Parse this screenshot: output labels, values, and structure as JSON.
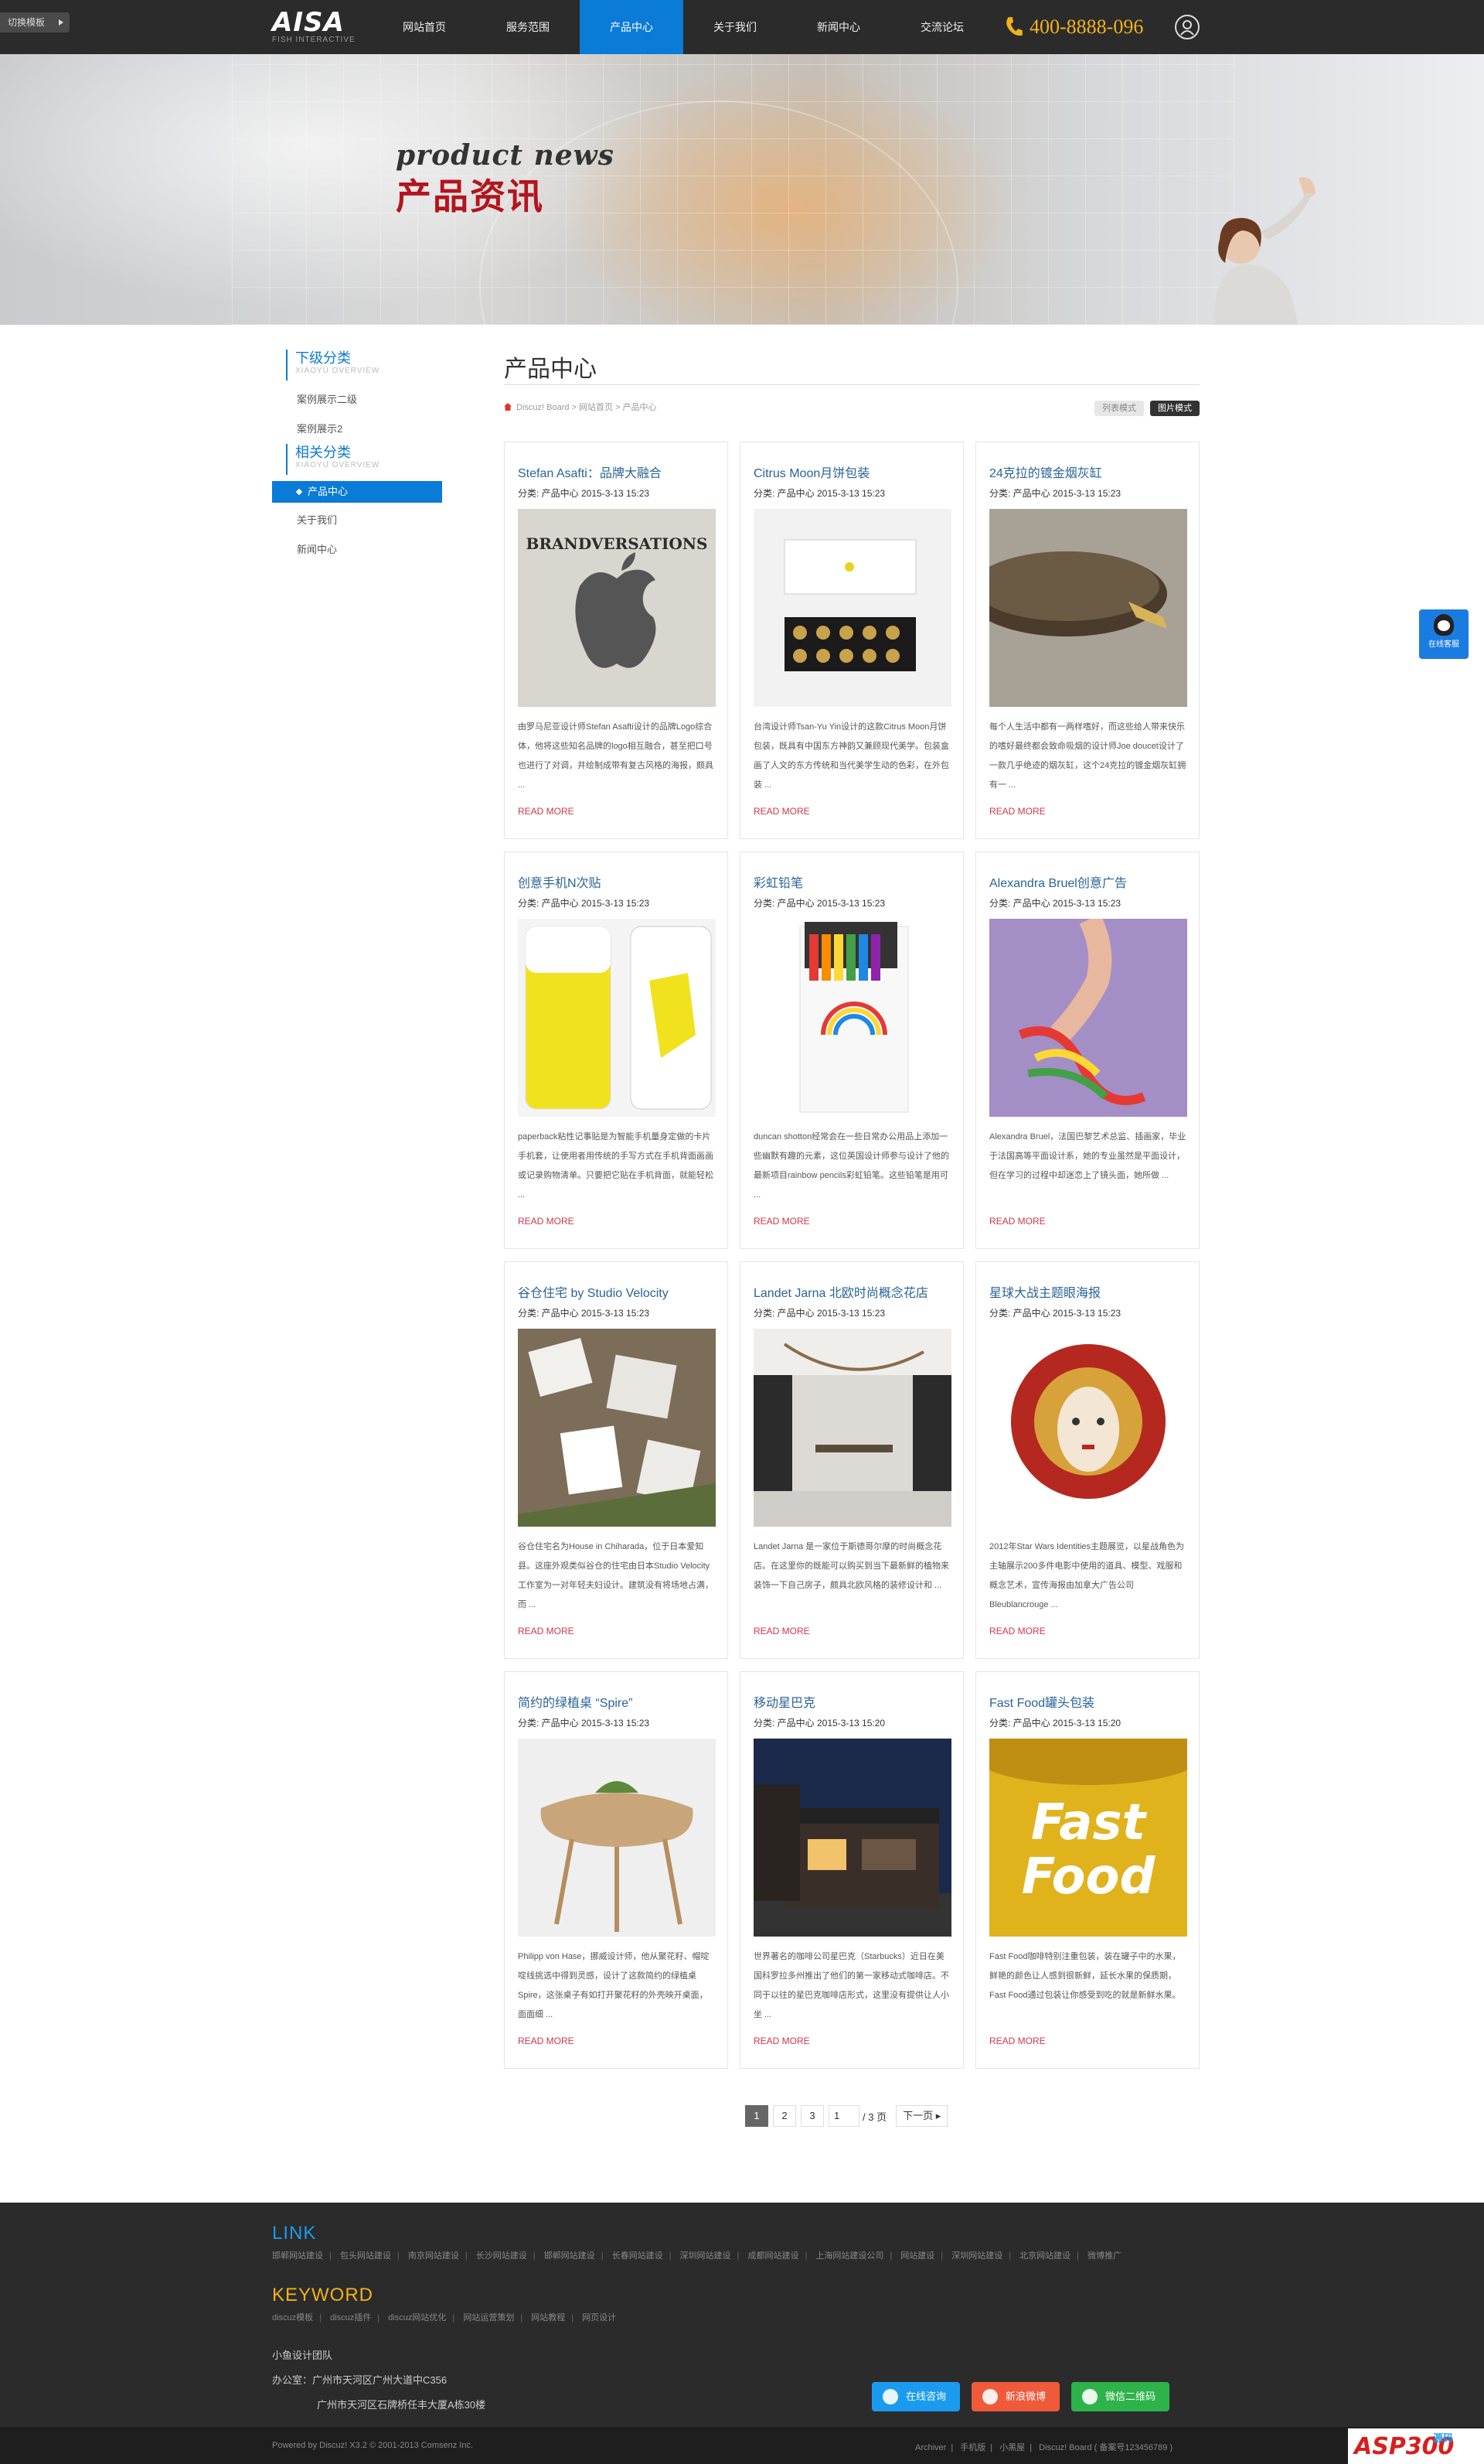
{
  "topbar": {
    "switch_label": "切换模板",
    "logo_text": "AISA",
    "logo_sub": "FISH INTERACTIVE",
    "nav": [
      "网站首页",
      "服务范围",
      "产品中心",
      "关于我们",
      "新闻中心",
      "交流论坛"
    ],
    "nav_active": 2,
    "phone": "400-8888-096"
  },
  "banner": {
    "en": "product news",
    "cn": "产品资讯"
  },
  "sidebar": {
    "sub_title": "下级分类",
    "sub_en": "XIAOYU OVERVIEW",
    "sub_items": [
      "案例展示二级",
      "案例展示2"
    ],
    "rel_title": "相关分类",
    "rel_en": "XIAOYU OVERVIEW",
    "rel_items": [
      "产品中心",
      "关于我们",
      "新闻中心"
    ]
  },
  "main": {
    "title": "产品中心",
    "breadcrumb": "Discuz! Board > 网站首页 > 产品中心",
    "mode_list": "列表模式",
    "mode_pic": "图片模式",
    "read_more": "READ MORE",
    "cards": [
      {
        "title": "Stefan Asafti：品牌大融合",
        "meta": "分类: 产品中心   2015-3-13 15:23",
        "desc": "由罗马尼亚设计师Stefan Asafti设计的品牌Logo综合体，他将这些知名品牌的logo相互融合，甚至把口号也进行了对调，并绘制成带有复古风格的海报，颇具 ..."
      },
      {
        "title": "Citrus Moon月饼包装",
        "meta": "分类: 产品中心   2015-3-13 15:23",
        "desc": "台湾设计师Tsan-Yu Yin设计的这款Citrus Moon月饼包装，既具有中国东方神韵又兼顾现代美学。包装盒画了人文的东方传统和当代美学生动的色彩，在外包装 ..."
      },
      {
        "title": "24克拉的镀金烟灰缸",
        "meta": "分类: 产品中心   2015-3-13 15:23",
        "desc": "每个人生活中都有一两样嗜好，而这些给人带来快乐的嗜好最终都会致命吸烟的设计师Joe doucet设计了一款几乎绝迹的烟灰缸，这个24克拉的镀金烟灰缸拥有一 ..."
      },
      {
        "title": "创意手机N次贴",
        "meta": "分类: 产品中心   2015-3-13 15:23",
        "desc": "paperback粘性记事贴是为智能手机量身定做的卡片手机套，让使用者用传统的手写方式在手机背面画画或记录购物清单。只要把它贴在手机背面，就能轻松 ..."
      },
      {
        "title": "彩虹铅笔",
        "meta": "分类: 产品中心   2015-3-13 15:23",
        "desc": "duncan shotton经常会在一些日常办公用品上添加一些幽默有趣的元素，这位英国设计师参与设计了他的最新项目rainbow pencils彩虹铅笔。这些铅笔是用可 ..."
      },
      {
        "title": "Alexandra Bruel创意广告",
        "meta": "分类: 产品中心   2015-3-13 15:23",
        "desc": "Alexandra Bruel，法国巴黎艺术总监、插画家，毕业于法国高等平面设计系，她的专业虽然是平面设计，但在学习的过程中却迷恋上了镜头面，她所做 ..."
      },
      {
        "title": "谷仓住宅 by Studio Velocity",
        "meta": "分类: 产品中心   2015-3-13 15:23",
        "desc": "谷仓住宅名为House in Chiharada，位于日本爱知县。这座外观类似谷仓的住宅由日本Studio Velocity工作室为一对年轻夫妇设计。建筑没有将场地占满，而 ..."
      },
      {
        "title": "Landet Jarna 北欧时尚概念花店",
        "meta": "分类: 产品中心   2015-3-13 15:23",
        "desc": "Landet Jarna 是一家位于斯德哥尔摩的时尚概念花店。在这里你的既能可以购买到当下最新鲜的植物来装饰一下自己房子，颇具北欧风格的装修设计和 ..."
      },
      {
        "title": "星球大战主题眼海报",
        "meta": "分类: 产品中心   2015-3-13 15:23",
        "desc": "2012年Star Wars Identities主题展览，以星战角色为主轴展示200多件电影中使用的道具、模型、戏服和概念艺术，宣传海报由加拿大广告公司Bleublancrouge ..."
      },
      {
        "title": "简约的绿植桌 “Spire”",
        "meta": "分类: 产品中心   2015-3-13 15:23",
        "desc": "Philipp von Hase，挪威设计师，他从聚花籽、帽啶啶线挑选中得到灵感，设计了这款简约的绿植桌Spire，这张桌子有如打开聚花籽的外壳映开桌面，面面细 ..."
      },
      {
        "title": "移动星巴克",
        "meta": "分类: 产品中心   2015-3-13 15:20",
        "desc": "世界著名的咖啡公司星巴克（Starbucks）近日在美国科罗拉多州推出了他们的第一家移动式咖啡店。不同于以往的星巴克咖啡店形式，这里没有提供让人小坐 ..."
      },
      {
        "title": "Fast Food罐头包装",
        "meta": "分类: 产品中心   2015-3-13 15:20",
        "desc": "Fast Food咖啡特别注重包装，装在罐子中的水果，鲜艳的颜色让人感到很新鲜，延长水果的保质期，Fast Food通过包装让你感受到吃的就是新鲜水果。"
      }
    ]
  },
  "pager": {
    "pages": [
      "1",
      "2",
      "3"
    ],
    "current": "1",
    "total": "/ 3 页",
    "next": "下一页"
  },
  "footer": {
    "link_title": "LINK",
    "links": [
      "邯郸网站建设",
      "包头网站建设",
      "南京网站建设",
      "长沙网站建设",
      "邯郸网站建设",
      "长春网站建设",
      "深圳网站建设",
      "成都网站建设",
      "上海网站建设公司",
      "网站建设",
      "深圳网站建设",
      "北京网站建设",
      "微博推广"
    ],
    "keyword_title": "KEYWORD",
    "keywords": [
      "discuz模板",
      "discuz插件",
      "discuz网站优化",
      "网站运营策划",
      "网站教程",
      "网页设计"
    ],
    "team": "小鱼设计团队",
    "office1": "办公室：广州市天河区广州大道中C356",
    "office2": "广州市天河区石牌桥任丰大厦A栋30楼",
    "btn_qq": "在线咨询",
    "btn_weibo": "新浪微博",
    "btn_wechat": "微信二维码",
    "powered": "Powered by Discuz! X3.2 © 2001-2013 Comsenz Inc.",
    "bottom_links": [
      "Archiver",
      "手机版",
      "小黑屋",
      "Discuz! Board ( 备案号123456789 )"
    ],
    "watermark": "ASP300",
    "watermark_sub": "源码"
  },
  "float": {
    "qq_label": "在线客服"
  },
  "colors": {
    "accent": "#0a7bd6",
    "phone": "#f2b21c",
    "more": "#d0364f",
    "dark": "#2b2b2b"
  }
}
